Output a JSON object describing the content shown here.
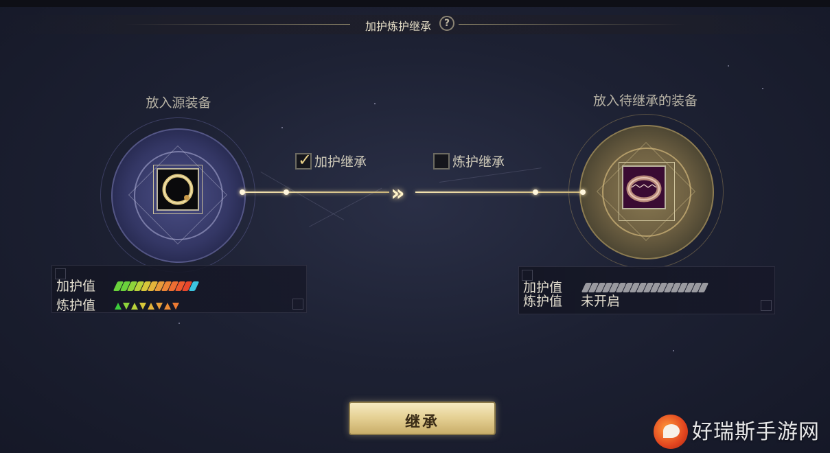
{
  "header": {
    "title": "加护炼护继承",
    "help_glyph": "?"
  },
  "source_slot": {
    "label": "放入源装备",
    "item_icon": "black-gold-ring-icon"
  },
  "target_slot": {
    "label": "放入待继承的装备",
    "item_icon": "engraved-bracelet-icon"
  },
  "options": [
    {
      "label": "加护继承",
      "checked": true
    },
    {
      "label": "炼护继承",
      "checked": false
    }
  ],
  "source_stats": {
    "guard_label": "加护值",
    "refine_label": "炼护值",
    "guard_pips": [
      "#6ad23c",
      "#6ad23c",
      "#8fd43a",
      "#b9d23a",
      "#d8c83a",
      "#e4b43a",
      "#e89a3a",
      "#ec8436",
      "#ee6e32",
      "#ee5a2e",
      "#e8472c",
      "#3cc4e0"
    ],
    "refine_tris": [
      {
        "dir": "up",
        "color": "#3ccc3c"
      },
      {
        "dir": "down",
        "color": "#8ed43a"
      },
      {
        "dir": "up",
        "color": "#b9d23a"
      },
      {
        "dir": "down",
        "color": "#d8c83a"
      },
      {
        "dir": "up",
        "color": "#e4b43a"
      },
      {
        "dir": "down",
        "color": "#e8a03a"
      },
      {
        "dir": "up",
        "color": "#ec8c36"
      },
      {
        "dir": "down",
        "color": "#ee7a32"
      }
    ]
  },
  "target_stats": {
    "guard_label": "加护值",
    "refine_label": "炼护值",
    "refine_value": "未开启",
    "guard_pips_empty": 18,
    "empty_color": "#9a9aa0"
  },
  "action_button": {
    "label": "继承"
  },
  "watermark": {
    "text": "好瑞斯手游网"
  }
}
